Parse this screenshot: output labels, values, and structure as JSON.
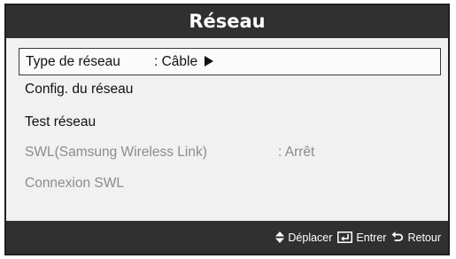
{
  "dialog": {
    "title": "Réseau"
  },
  "menu": {
    "items": [
      {
        "label": "Type de réseau",
        "value": ": Câble",
        "state": "selected",
        "has_submenu": true
      },
      {
        "label": "Config. du réseau",
        "value": "",
        "state": "enabled",
        "has_submenu": false
      },
      {
        "label": "Test réseau",
        "value": "",
        "state": "enabled",
        "has_submenu": false
      },
      {
        "label": "SWL(Samsung Wireless Link)",
        "value": ": Arrêt",
        "state": "disabled",
        "has_submenu": false
      },
      {
        "label": "Connexion SWL",
        "value": "",
        "state": "disabled",
        "has_submenu": false
      }
    ]
  },
  "footer": {
    "move_label": "Déplacer",
    "enter_label": "Entrer",
    "return_label": "Retour",
    "move_icon": "up-down-arrows-icon",
    "enter_icon": "enter-key-icon",
    "return_icon": "return-arrow-icon"
  },
  "colors": {
    "bar_background": "#303030",
    "panel_background": "#f1f1f1",
    "text": "#111111",
    "disabled_text": "#8c8c8c"
  }
}
